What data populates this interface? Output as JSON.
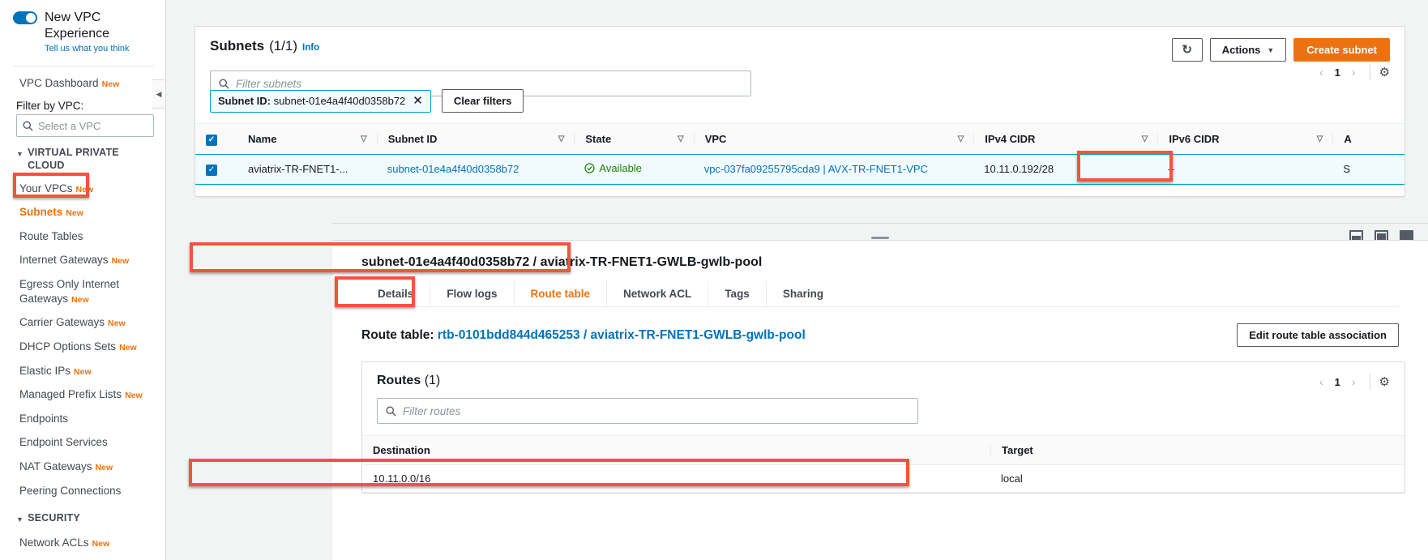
{
  "sidebar": {
    "new_experience": {
      "title": "New VPC Experience",
      "feedback_link": "Tell us what you think",
      "toggle_on": true
    },
    "dashboard": {
      "label": "VPC Dashboard",
      "badge": "New"
    },
    "filter_label": "Filter by VPC:",
    "vpc_search_placeholder": "Select a VPC",
    "vpc_search_value": "",
    "groups": [
      {
        "title": "VIRTUAL PRIVATE CLOUD",
        "items": [
          {
            "label": "Your VPCs",
            "badge": "New",
            "selected": false
          },
          {
            "label": "Subnets",
            "badge": "New",
            "selected": true
          },
          {
            "label": "Route Tables",
            "badge": "",
            "selected": false
          },
          {
            "label": "Internet Gateways",
            "badge": "New",
            "selected": false
          },
          {
            "label": "Egress Only Internet Gateways",
            "badge": "New",
            "selected": false
          },
          {
            "label": "Carrier Gateways",
            "badge": "New",
            "selected": false
          },
          {
            "label": "DHCP Options Sets",
            "badge": "New",
            "selected": false
          },
          {
            "label": "Elastic IPs",
            "badge": "New",
            "selected": false
          },
          {
            "label": "Managed Prefix Lists",
            "badge": "New",
            "selected": false
          },
          {
            "label": "Endpoints",
            "badge": "",
            "selected": false
          },
          {
            "label": "Endpoint Services",
            "badge": "",
            "selected": false
          },
          {
            "label": "NAT Gateways",
            "badge": "New",
            "selected": false
          },
          {
            "label": "Peering Connections",
            "badge": "",
            "selected": false
          }
        ]
      },
      {
        "title": "SECURITY",
        "items": [
          {
            "label": "Network ACLs",
            "badge": "New",
            "selected": false
          }
        ]
      }
    ]
  },
  "subnets_panel": {
    "title": "Subnets",
    "count": "(1/1)",
    "info": "Info",
    "refresh_icon": "refresh-icon",
    "actions_label": "Actions",
    "create_label": "Create subnet",
    "filter_placeholder": "Filter subnets",
    "filter_value": "",
    "token": {
      "key": "Subnet ID:",
      "value": "subnet-01e4a4f40d0358b72"
    },
    "clear_filters_label": "Clear filters",
    "pagination": {
      "page": "1",
      "prev": "‹",
      "next": "›"
    },
    "settings_icon": "gear-icon",
    "columns": [
      "Name",
      "Subnet ID",
      "State",
      "VPC",
      "IPv4 CIDR",
      "IPv6 CIDR",
      "A"
    ],
    "rows": [
      {
        "selected": true,
        "name": "aviatrix-TR-FNET1-...",
        "subnet_id": "subnet-01e4a4f40d0358b72",
        "state": "Available",
        "vpc": "vpc-037fa09255795cda9 | AVX-TR-FNET1-VPC",
        "ipv4_cidr": "10.11.0.192/28",
        "ipv6_cidr": "–",
        "extra": "S"
      }
    ]
  },
  "splitter": {
    "collapse_icon": "panel-collapse-icon",
    "side_icon": "panel-side-icon",
    "full_icon": "panel-full-icon"
  },
  "detail": {
    "title": "subnet-01e4a4f40d0358b72 / aviatrix-TR-FNET1-GWLB-gwlb-pool",
    "tabs": [
      {
        "label": "Details",
        "active": false
      },
      {
        "label": "Flow logs",
        "active": false
      },
      {
        "label": "Route table",
        "active": true
      },
      {
        "label": "Network ACL",
        "active": false
      },
      {
        "label": "Tags",
        "active": false
      },
      {
        "label": "Sharing",
        "active": false
      }
    ],
    "route_table": {
      "prefix": "Route table:",
      "link": "rtb-0101bdd844d465253 / aviatrix-TR-FNET1-GWLB-gwlb-pool",
      "edit_button": "Edit route table association"
    },
    "routes": {
      "title": "Routes",
      "count": "(1)",
      "filter_placeholder": "Filter routes",
      "filter_value": "",
      "pagination": {
        "page": "1",
        "prev": "‹",
        "next": "›"
      },
      "settings_icon": "gear-icon",
      "columns": [
        "Destination",
        "Target"
      ],
      "rows": [
        {
          "destination": "10.11.0.0/16",
          "target": "local"
        }
      ]
    }
  },
  "highlights": {
    "color": "#f4533d",
    "boxes": [
      "sidebar-subnets",
      "ipv4-cidr-cell",
      "detail-title",
      "route-table-tab",
      "route-row"
    ]
  }
}
